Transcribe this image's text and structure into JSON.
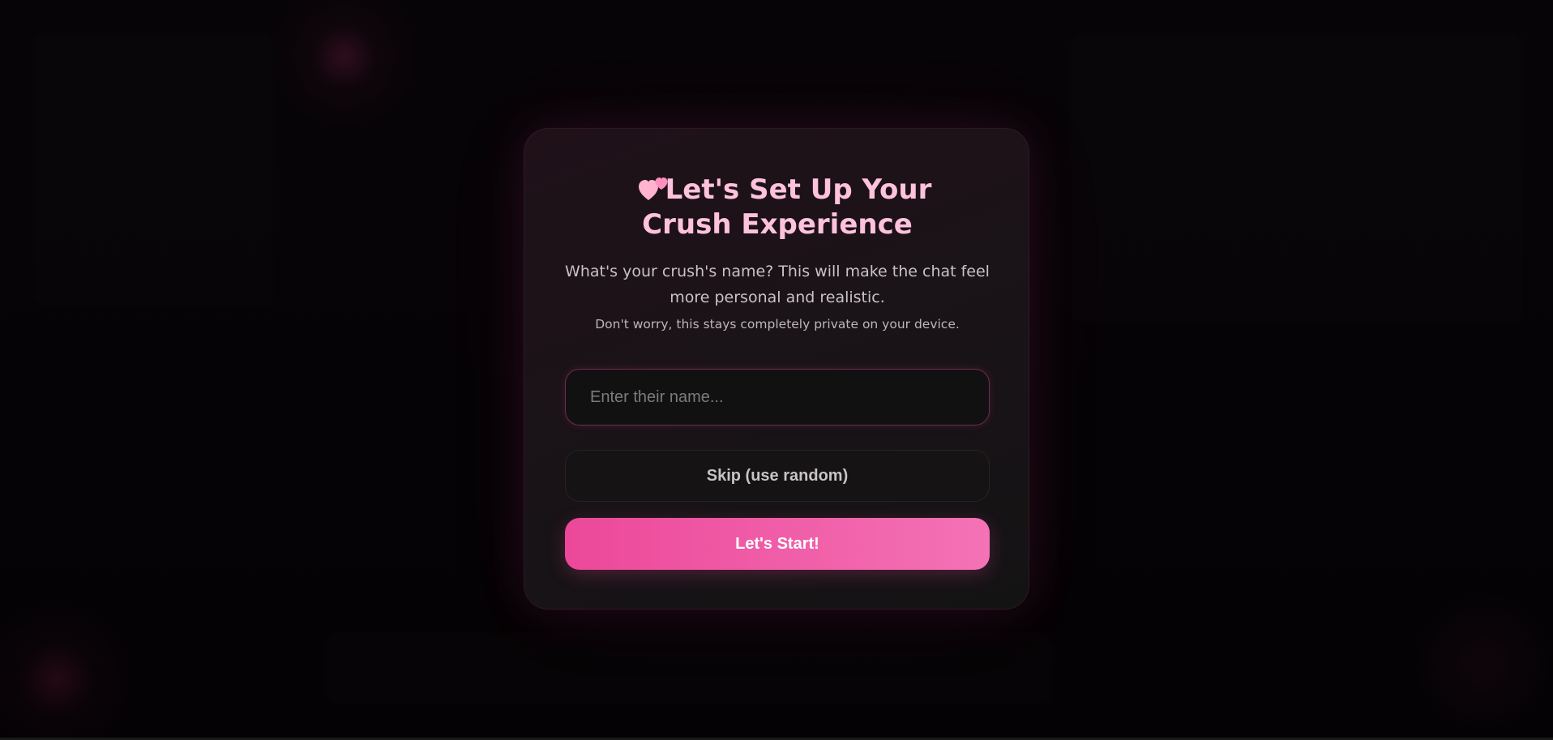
{
  "modal": {
    "title": "Let's Set Up Your Crush Experience",
    "title_icon": "two-hearts-icon",
    "subtitle": "What's your crush's name? This will make the chat feel more personal and realistic.",
    "privacy_note": "Don't worry, this stays completely private on your device.",
    "name_input": {
      "value": "",
      "placeholder": "Enter their name..."
    },
    "skip_label": "Skip (use random)",
    "start_label": "Let's Start!"
  },
  "colors": {
    "accent_start": "#ec4899",
    "accent_end": "#f472b6",
    "title": "#ffc2dc",
    "background": "#050305",
    "modal_background": "#1a1318"
  }
}
